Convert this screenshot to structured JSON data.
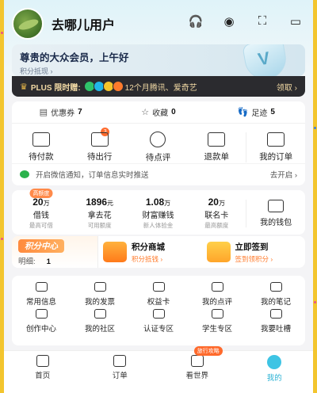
{
  "header": {
    "username": "去哪儿用户"
  },
  "icons": {
    "service": "headset-icon",
    "eye": "eye-icon",
    "scan": "scan-icon",
    "message": "message-icon"
  },
  "member": {
    "title": "尊贵的大众会员，上午好",
    "sub": "积分抵现 ›"
  },
  "plus": {
    "title": "PLUS 限时赠:",
    "text": "12个月腾讯、爱奇艺",
    "link": "领取 ›"
  },
  "stats": [
    {
      "label": "优惠券",
      "value": "7"
    },
    {
      "label": "收藏",
      "value": "0"
    },
    {
      "label": "足迹",
      "value": "5"
    }
  ],
  "orders": [
    {
      "label": "待付款"
    },
    {
      "label": "待出行",
      "badge": "3"
    },
    {
      "label": "待点评"
    },
    {
      "label": "退款单"
    },
    {
      "label": "我的订单"
    }
  ],
  "wechat": {
    "text": "开启微信通知，订单信息实时推送",
    "link": "去开启 ›"
  },
  "wallet": [
    {
      "tag": "高额度",
      "value": "20",
      "unit": "万",
      "name": "借钱",
      "sub": "最高可借"
    },
    {
      "tag": "",
      "value": "1896",
      "unit": "元",
      "name": "拿去花",
      "sub": "可用额度"
    },
    {
      "tag": "",
      "value": "1.08",
      "unit": "万",
      "name": "财富赚钱",
      "sub": "新人体验金"
    },
    {
      "tag": "",
      "value": "20",
      "unit": "万",
      "name": "联名卡",
      "sub": "最高额度"
    },
    {
      "tag": "",
      "value": "",
      "unit": "",
      "name": "我的钱包",
      "sub": ""
    }
  ],
  "points": {
    "title": "积分中心",
    "detail_label": "明细:",
    "detail_value": "1",
    "mall": {
      "name": "积分商城",
      "sub": "积分抵钱 ›"
    },
    "signin": {
      "name": "立即签到",
      "sub": "签到领积分 ›"
    }
  },
  "grid": [
    "常用信息",
    "我的发票",
    "权益卡",
    "我的点评",
    "我的笔记",
    "创作中心",
    "我的社区",
    "认证专区",
    "学生专区",
    "我要吐槽"
  ],
  "nav": [
    {
      "label": "首页",
      "tag": ""
    },
    {
      "label": "订单",
      "tag": ""
    },
    {
      "label": "看世界",
      "tag": "旅行攻略"
    },
    {
      "label": "我的",
      "tag": ""
    }
  ],
  "colors": {
    "background": "#f3c52e",
    "accent": "#3ec4e4",
    "orange": "#ff7a2a"
  }
}
